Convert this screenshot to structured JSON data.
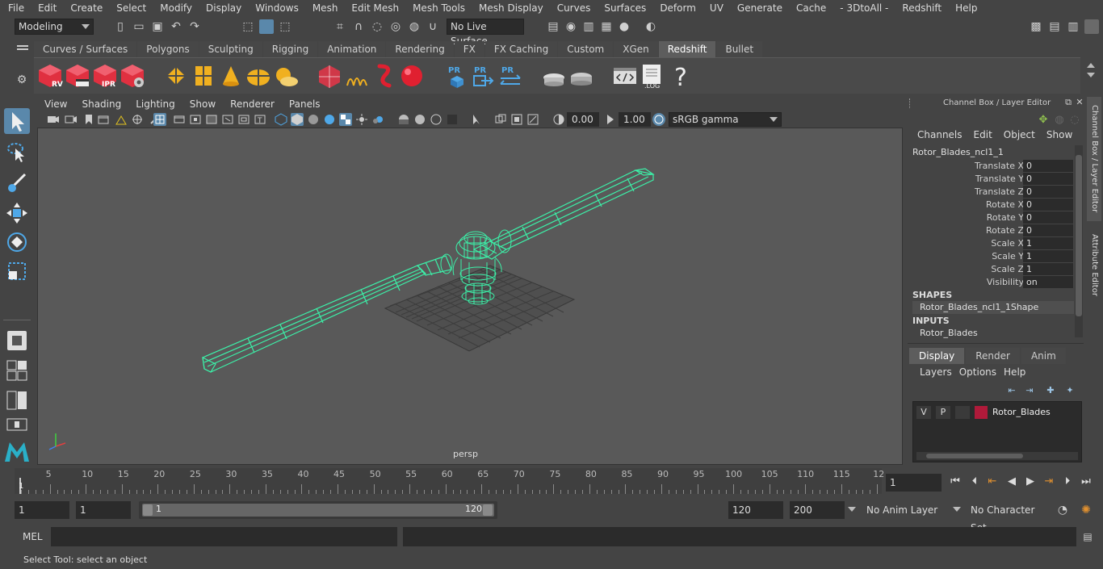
{
  "menubar": [
    "File",
    "Edit",
    "Create",
    "Select",
    "Modify",
    "Display",
    "Windows",
    "Mesh",
    "Edit Mesh",
    "Mesh Tools",
    "Mesh Display",
    "Curves",
    "Surfaces",
    "Deform",
    "UV",
    "Generate",
    "Cache",
    "- 3DtoAll -",
    "Redshift",
    "Help"
  ],
  "status": {
    "workspace": "Modeling",
    "live_surface": "No Live Surface"
  },
  "shelf_tabs": [
    "Curves / Surfaces",
    "Polygons",
    "Sculpting",
    "Rigging",
    "Animation",
    "Rendering",
    "FX",
    "FX Caching",
    "Custom",
    "XGen",
    "Redshift",
    "Bullet"
  ],
  "shelf_active": "Redshift",
  "shelf_icon_labels": {
    "rv": "RV",
    "ipr": "IPR",
    "pr": "PR",
    "log": ".LOG",
    "help": "?"
  },
  "viewport": {
    "menu": [
      "View",
      "Shading",
      "Lighting",
      "Show",
      "Renderer",
      "Panels"
    ],
    "exposure": "0.00",
    "gamma": "1.00",
    "color_space": "sRGB gamma",
    "camera_label": "persp"
  },
  "channel_box": {
    "title": "Channel Box / Layer Editor",
    "menu": [
      "Channels",
      "Edit",
      "Object",
      "Show"
    ],
    "object_name": "Rotor_Blades_ncl1_1",
    "attributes": [
      {
        "label": "Translate X",
        "value": "0"
      },
      {
        "label": "Translate Y",
        "value": "0"
      },
      {
        "label": "Translate Z",
        "value": "0"
      },
      {
        "label": "Rotate X",
        "value": "0"
      },
      {
        "label": "Rotate Y",
        "value": "0"
      },
      {
        "label": "Rotate Z",
        "value": "0"
      },
      {
        "label": "Scale X",
        "value": "1"
      },
      {
        "label": "Scale Y",
        "value": "1"
      },
      {
        "label": "Scale Z",
        "value": "1"
      },
      {
        "label": "Visibility",
        "value": "on"
      }
    ],
    "shapes_header": "SHAPES",
    "shape_name": "Rotor_Blades_ncl1_1Shape",
    "inputs_header": "INPUTS",
    "input_name": "Rotor_Blades"
  },
  "layer_editor": {
    "tabs": [
      "Display",
      "Render",
      "Anim"
    ],
    "active_tab": "Display",
    "menu": [
      "Layers",
      "Options",
      "Help"
    ],
    "layer": {
      "v": "V",
      "p": "P",
      "name": "Rotor_Blades",
      "color": "#b01a3a"
    }
  },
  "side_tabs": [
    "Channel Box / Layer Editor",
    "Attribute Editor"
  ],
  "timeline": {
    "ticks": [
      "5",
      "10",
      "15",
      "20",
      "25",
      "30",
      "35",
      "40",
      "45",
      "50",
      "55",
      "60",
      "65",
      "70",
      "75",
      "80",
      "85",
      "90",
      "95",
      "100",
      "105",
      "110",
      "115",
      "12"
    ],
    "current_frame_label": "1",
    "current_frame": "1"
  },
  "range": {
    "start": "1",
    "playback_start": "1",
    "range_start_label": "1",
    "range_end_label": "120",
    "playback_end": "120",
    "end": "200",
    "anim_layer": "No Anim Layer",
    "character_set": "No Character Set"
  },
  "mel": {
    "label": "MEL"
  },
  "helpline": "Select Tool: select an object",
  "colors": {
    "accent": "#5a88ab",
    "wireframe": "#3cf0a8",
    "layer": "#b01a3a"
  }
}
